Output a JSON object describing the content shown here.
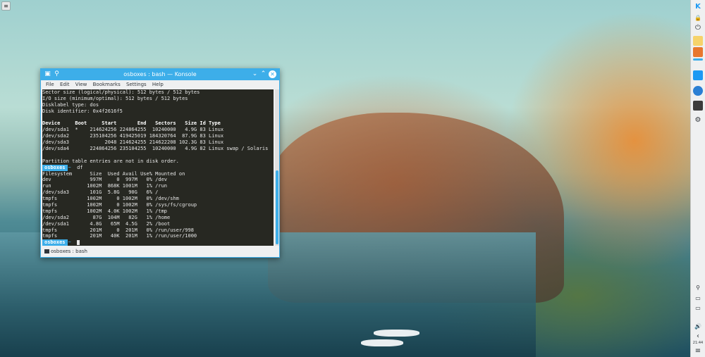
{
  "desktop": {
    "toolbox_glyph": "≡"
  },
  "window": {
    "title": "osboxes : bash — Konsole",
    "icon_glyph": "▣",
    "pin_glyph": "⚲",
    "min_glyph": "⌄",
    "max_glyph": "⌃",
    "close_glyph": "✕"
  },
  "menu": {
    "items": [
      "File",
      "Edit",
      "View",
      "Bookmarks",
      "Settings",
      "Help"
    ]
  },
  "terminal": {
    "lines": [
      {
        "text": "Sector size (logical/physical): 512 bytes / 512 bytes"
      },
      {
        "text": "I/O size (minimum/optimal): 512 bytes / 512 bytes"
      },
      {
        "text": "Disklabel type: dos"
      },
      {
        "text": "Disk identifier: 0x4f2616f5"
      },
      {
        "text": ""
      },
      {
        "text": "Device     Boot     Start       End   Sectors   Size Id Type",
        "bold": true
      },
      {
        "text": "/dev/sda1  *    214624256 224864255  10240000   4.9G 83 Linux"
      },
      {
        "text": "/dev/sda2       235104256 419425019 184320764  87.9G 83 Linux"
      },
      {
        "text": "/dev/sda3            2048 214624255 214622208 102.3G 83 Linux"
      },
      {
        "text": "/dev/sda4       224864256 235104255  10240000   4.9G 82 Linux swap / Solaris"
      },
      {
        "text": ""
      },
      {
        "text": "Partition table entries are not in disk order."
      },
      {
        "prompt": "osboxes",
        "arrow": "~",
        "command": "df"
      },
      {
        "text": "Filesystem      Size  Used Avail Use% Mounted on"
      },
      {
        "text": "dev             997M     0  997M   0% /dev"
      },
      {
        "text": "run            1002M  868K 1001M   1% /run"
      },
      {
        "text": "/dev/sda3       101G  5.8G   90G   6% /"
      },
      {
        "text": "tmpfs          1002M     0 1002M   0% /dev/shm"
      },
      {
        "text": "tmpfs          1002M     0 1002M   0% /sys/fs/cgroup"
      },
      {
        "text": "tmpfs          1002M  4.0K 1002M   1% /tmp"
      },
      {
        "text": "/dev/sda2        87G  104M   82G   1% /home"
      },
      {
        "text": "/dev/sda1       4.8G   65M  4.5G   2% /boot"
      },
      {
        "text": "tmpfs           201M     0  201M   0% /run/user/998"
      },
      {
        "text": "tmpfs           201M   40K  201M   1% /run/user/1000"
      },
      {
        "prompt": "osboxes",
        "arrow": "~",
        "command": "",
        "cursor": true
      }
    ]
  },
  "tab": {
    "label": "osboxes : bash"
  },
  "panel": {
    "logo_glyph": "K",
    "lock_glyph": "🔒",
    "power_glyph": "⏻",
    "settings_glyph": "⚙",
    "usb_glyph": "⚲",
    "clipboard_glyph": "▭",
    "display_glyph": "▭",
    "volume_glyph": "🔊",
    "expand_glyph": "‹",
    "clock": "21:44",
    "menu_glyph": "≡",
    "accent": "#3daee9"
  }
}
